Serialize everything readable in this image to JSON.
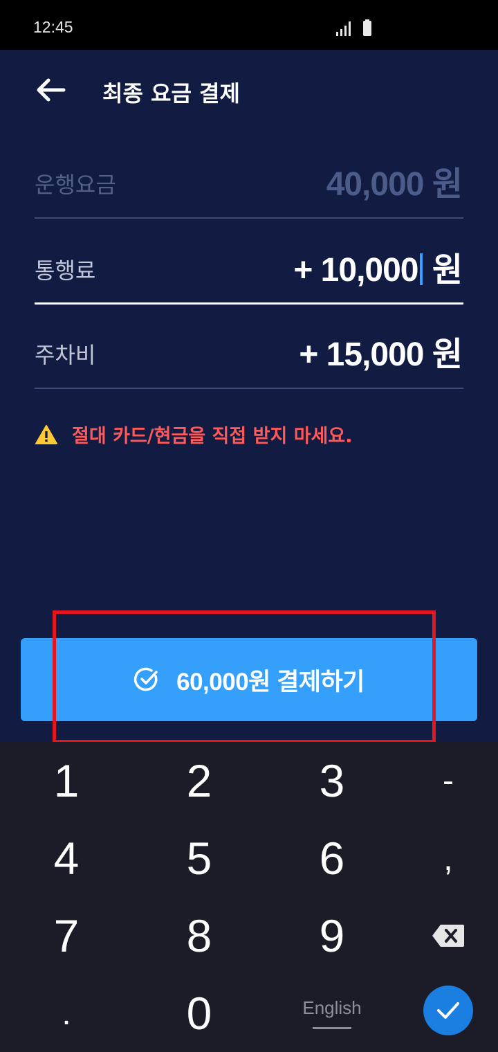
{
  "status_bar": {
    "time": "12:45",
    "icons": [
      "signal-icon",
      "battery-icon"
    ]
  },
  "header": {
    "title": "최종 요금 결제",
    "back_icon": "arrow-left-icon"
  },
  "fare": {
    "label": "운행요금",
    "value": "40,000 원"
  },
  "toll": {
    "label": "통행료",
    "value_prefix": "+ 10,000",
    "value_suffix": " 원"
  },
  "parking": {
    "label": "주차비",
    "value": "+ 15,000 원"
  },
  "warning": {
    "icon": "warning-icon",
    "text": "절대 카드/현금을 직접 받지 마세요."
  },
  "pay_button": {
    "label": "60,000원 결제하기",
    "icon": "check-circle-icon"
  },
  "keyboard": {
    "keys": [
      "1",
      "2",
      "3",
      "-",
      "4",
      "5",
      "6",
      ",",
      "7",
      "8",
      "9",
      "backspace-icon",
      ".",
      "0",
      "English",
      "check-icon"
    ]
  },
  "colors": {
    "background": "#121c42",
    "accent": "#35a0fb",
    "warning": "#ff5a5a",
    "keyboard_bg": "#1b1c27",
    "highlight": "#e4171f"
  }
}
